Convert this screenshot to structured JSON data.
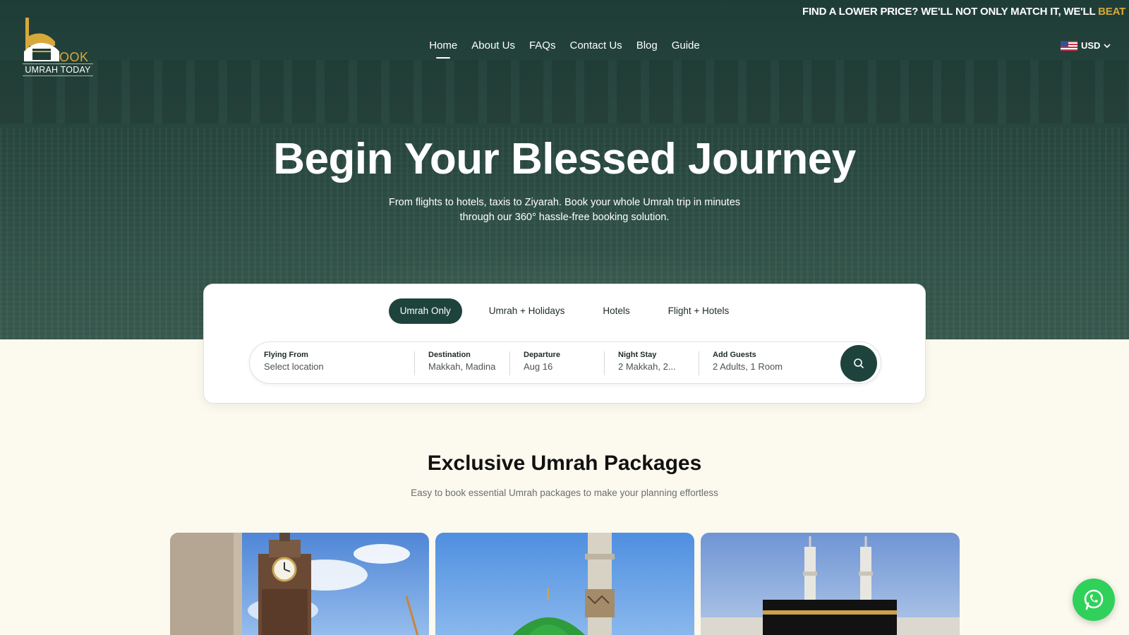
{
  "announcement": {
    "text": "FIND A LOWER PRICE? WE'LL NOT ONLY MATCH IT, WE'LL",
    "accent": "BEAT"
  },
  "logo": {
    "mark_text": "OOK",
    "subtitle": "UMRAH TODAY"
  },
  "nav": {
    "items": [
      {
        "label": "Home",
        "active": true
      },
      {
        "label": "About Us"
      },
      {
        "label": "FAQs"
      },
      {
        "label": "Contact Us"
      },
      {
        "label": "Blog"
      },
      {
        "label": "Guide"
      }
    ]
  },
  "currency": {
    "code": "USD",
    "flag_icon": "us-flag-icon"
  },
  "hero": {
    "title": "Begin Your Blessed Journey",
    "subtitle_line1": "From flights to hotels, taxis to Ziyarah. Book your whole Umrah trip in minutes",
    "subtitle_line2": "through our 360° hassle-free booking solution."
  },
  "search": {
    "tabs": [
      {
        "label": "Umrah Only",
        "active": true
      },
      {
        "label": "Umrah + Holidays"
      },
      {
        "label": "Hotels"
      },
      {
        "label": "Flight + Hotels"
      }
    ],
    "fields": {
      "flying_from": {
        "label": "Flying From",
        "value": "Select location"
      },
      "destination": {
        "label": "Destination",
        "value": "Makkah, Madina"
      },
      "departure": {
        "label": "Departure",
        "value": "Aug 16"
      },
      "night_stay": {
        "label": "Night Stay",
        "value": "2 Makkah, 2..."
      },
      "guests": {
        "label": "Add Guests",
        "value": "2 Adults, 1 Room"
      }
    },
    "search_icon": "search-icon"
  },
  "packages": {
    "title": "Exclusive Umrah Packages",
    "subtitle": "Easy to book essential Umrah packages to make your planning effortless"
  },
  "colors": {
    "brand_dark": "#1e433d",
    "accent_gold": "#d7a93a",
    "page_bg": "#fcf9ef",
    "whatsapp": "#2fd15a"
  }
}
